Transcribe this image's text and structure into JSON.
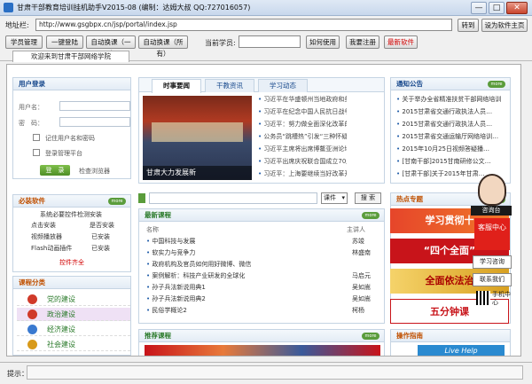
{
  "window": {
    "title": "甘肃干部教育培训挂机助手V2015-08 (编制：达姆大叔 QQ:727016057)",
    "minimize": "—",
    "maximize": "□",
    "close": "✕"
  },
  "address": {
    "label": "地址栏:",
    "url": "http://www.gsgbpx.cn/jsp/portal/index.jsp",
    "go": "转到",
    "set_home": "设为软件主页"
  },
  "toolbar": {
    "buttons": [
      "学员管理",
      "一键登陆",
      "自动换课（一页）",
      "自动换课（所有）"
    ],
    "current_label": "当前学员:",
    "use": "如何使用",
    "register": "我要注册",
    "latest": "最新软件"
  },
  "browser_tab": "欢迎来到甘肃干部网络学院",
  "login": {
    "title": "用户登录",
    "username": "用户名：",
    "password": "密　码：",
    "remember": "记住用户名和密码",
    "platform": "登录管理平台",
    "login_btn": "登　录",
    "check_browser": "检查浏览器"
  },
  "news": {
    "tabs": [
      "时事要闻",
      "干教资讯",
      "学习动态"
    ],
    "photo_caption": "甘肃大力发展新",
    "items": [
      "习近平在华盛顿州当地政府和美国…",
      "习近平在纪念中国人民抗日战争暨…",
      "习近平：努力做全面深化改革的实…",
      "公务员“跳槽热”引发“三种怀疑…",
      "习近平主席将出席博鳌亚洲论坛2…",
      "习近平出席庆祝联合国成立70周…",
      "习近平：上海要继续当好改革开放…"
    ]
  },
  "notice": {
    "title": "通知公告",
    "more": "more",
    "items": [
      "关于举办全省精准扶贫干部网络培训…",
      "2015甘肃省交通行政执法人员…",
      "2015甘肃省交通行政执法人员…",
      "2015甘肃省交通运输厅网络培训…",
      "2015年10月25日视频答疑播…",
      "[甘南干部]2015甘南研修公文…",
      "[甘肃干部]关于2015年甘肃…"
    ]
  },
  "software": {
    "title": "必装软件",
    "more": "more",
    "subtitle": "系统必要控件检测安装",
    "rows": [
      [
        "点击安装",
        "是否安装"
      ],
      [
        "视频播放器",
        "已安装"
      ],
      [
        "Flash动画插件",
        "已安装"
      ]
    ],
    "fix": "控件齐全"
  },
  "search": {
    "select": "课件",
    "button": "搜 索"
  },
  "courses": {
    "title": "最新课程",
    "more": "more",
    "col_name": "名称",
    "col_lecturer": "主讲人",
    "items": [
      [
        "中国科技与发展",
        "苏竣"
      ],
      [
        "软实力与竞争力",
        "林盛南"
      ],
      [
        "政府机构及官员如何用好微博、微信",
        ""
      ],
      [
        "案例解析：科技产业研发的全球化",
        "马启元"
      ],
      [
        "孙子兵法新说用典1",
        "吴如嵩"
      ],
      [
        "孙子兵法新说用典2",
        "吴如嵩"
      ],
      [
        "民俗学概论2",
        "柯杨"
      ]
    ]
  },
  "category": {
    "title": "课程分类",
    "items": [
      "党的建设",
      "政治建设",
      "经济建设",
      "社会建设"
    ]
  },
  "hot": {
    "title": "热点专题",
    "more": "more",
    "banners": [
      "学习贯彻十",
      "“四个全面”",
      "全面依法治",
      "五分钟课"
    ]
  },
  "recommend": {
    "title": "推荐课程",
    "more": "more"
  },
  "guide": {
    "title": "操作指南"
  },
  "float": {
    "label": "咨询台",
    "service": "客服中心",
    "consult": "学习咨询",
    "contact": "联系我们",
    "phone": "手机中心",
    "live": "Live Help"
  },
  "status": {
    "label": "提示："
  },
  "colors": {
    "accent": "#17488c",
    "orange_head": "#c05000",
    "red": "#d20000",
    "green": "#5a9c3b"
  }
}
